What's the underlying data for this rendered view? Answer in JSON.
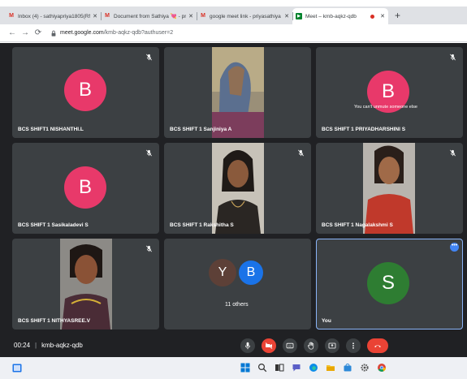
{
  "browser": {
    "tabs": [
      {
        "icon": "gmail-icon",
        "title": "Inbox (4) - sathiyapriya1805(RNr",
        "active": false
      },
      {
        "icon": "gmail-icon",
        "title": "Document from Sathiya 💘 - priy",
        "active": false
      },
      {
        "icon": "gmail-icon",
        "title": "google meet link - priyasathiya",
        "active": false
      },
      {
        "icon": "meet-icon",
        "title": "Meet – kmb-aqkz-qdb",
        "active": true
      }
    ],
    "url_host": "meet.google.com",
    "url_path": "/kmb-aqkz-qdb?authuser=2"
  },
  "participants": [
    {
      "name": "BCS SHIFT1 NISHANTHI.L",
      "avatar_letter": "B",
      "muted": true
    },
    {
      "name": "BCS SHIFT 1 Sanjiniya A",
      "video": true,
      "muted": false
    },
    {
      "name": "BCS SHIFT 1 PRIYADHARSHINI S",
      "avatar_letter": "B",
      "muted": true,
      "tooltip": "You can't unmute someone else"
    },
    {
      "name": "BCS SHIFT 1 Sasikaladevi S",
      "avatar_letter": "B",
      "muted": true
    },
    {
      "name": "BCS SHIFT 1 Rakshitha S",
      "video": true,
      "muted": true
    },
    {
      "name": "BCS SHIFT 1 Nagalakshmi S",
      "video": true,
      "muted": true
    },
    {
      "name": "BCS SHIFT 1 NITHYASREE.V",
      "video": true,
      "muted": true
    },
    {
      "name": "",
      "others_avatars": [
        "Y",
        "B"
      ],
      "others_label": "11 others"
    },
    {
      "name": "You",
      "avatar_letter": "S",
      "self": true
    }
  ],
  "meeting": {
    "time": "00:24",
    "code": "kmb-aqkz-qdb"
  },
  "colors": {
    "avatar_pink": "#e8396a",
    "avatar_green": "#2e7d32",
    "avatar_brown": "#5d4037",
    "avatar_blue": "#1a73e8",
    "hangup_red": "#ea4335",
    "stage_bg": "#202124",
    "tile_bg": "#3c4043"
  }
}
